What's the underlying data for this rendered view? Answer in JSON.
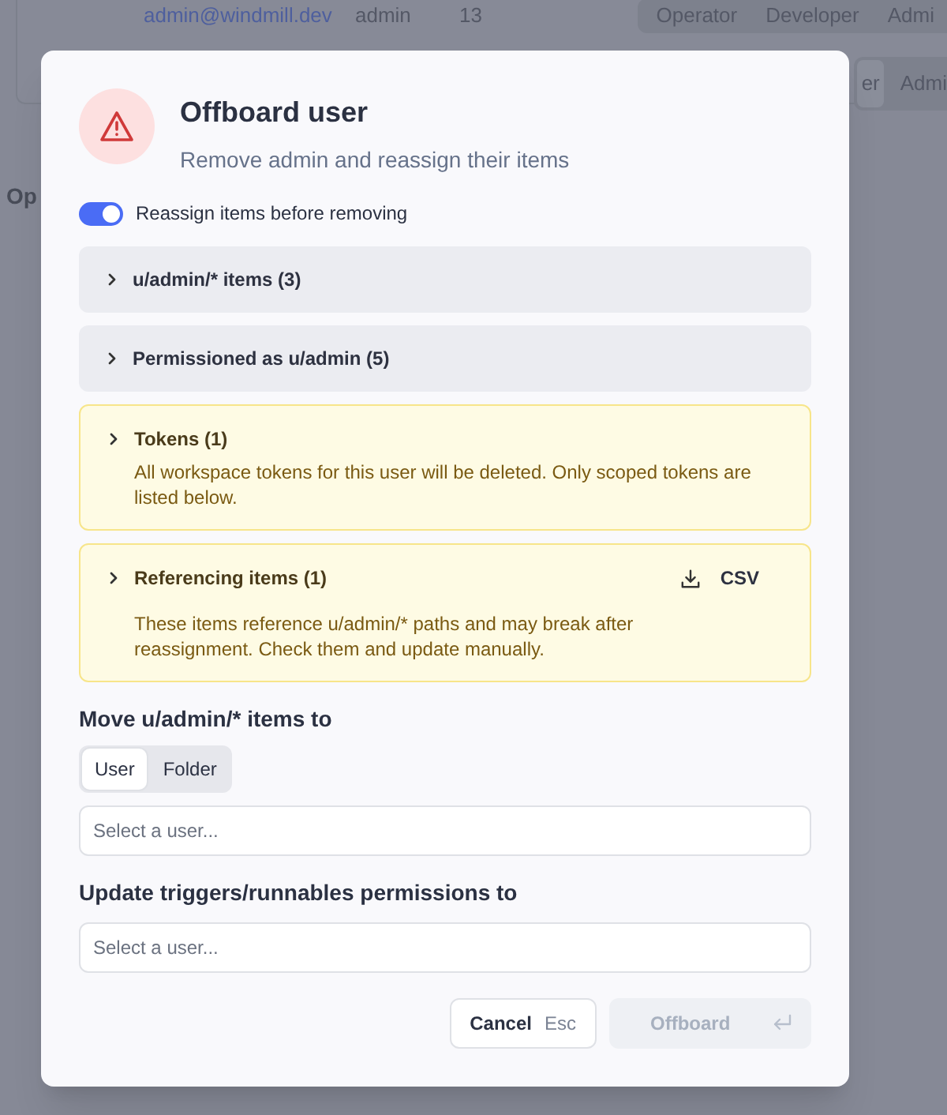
{
  "background": {
    "row": {
      "email": "admin@windmill.dev",
      "role": "admin",
      "count": "13",
      "options": [
        "Operator",
        "Developer",
        "Admi"
      ]
    },
    "row_2": {
      "options": [
        "er",
        "Admi"
      ]
    },
    "section_label": "Op"
  },
  "dialog": {
    "title": "Offboard user",
    "subtitle": "Remove admin and reassign their items",
    "toggle": {
      "label": "Reassign items before removing",
      "on": true
    },
    "sections": [
      {
        "kind": "plain",
        "title": "u/admin/* items (3)",
        "expanded": false
      },
      {
        "kind": "plain",
        "title": "Permissioned as u/admin (5)",
        "expanded": false
      },
      {
        "kind": "warning",
        "title": "Tokens (1)",
        "expanded": false,
        "description": "All workspace tokens for this user will be deleted. Only scoped tokens are listed below."
      },
      {
        "kind": "warning",
        "title": "Referencing items (1)",
        "expanded": false,
        "action": "CSV",
        "description": "These items reference u/admin/* paths and may break after reassignment. Check them and update manually."
      }
    ],
    "move": {
      "label": "Move u/admin/* items to",
      "options": [
        {
          "label": "User",
          "selected": true
        },
        {
          "label": "Folder",
          "selected": false
        }
      ],
      "field": {
        "placeholder": "Select a user..."
      }
    },
    "permissions": {
      "label": "Update triggers/runnables permissions to",
      "field": {
        "placeholder": "Select a user..."
      }
    },
    "buttons": [
      {
        "kind": "secondary",
        "label": "Cancel",
        "shortcut": "Esc",
        "disabled": false
      },
      {
        "kind": "primary",
        "label": "Offboard",
        "disabled": true
      }
    ]
  }
}
